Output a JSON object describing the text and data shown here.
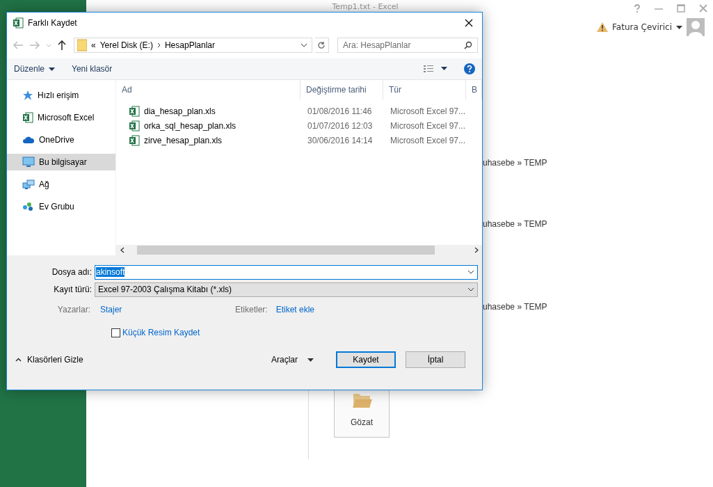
{
  "app_window": {
    "title": "Temp1.txt - Excel",
    "account": {
      "warning": "Fatura Çevirici"
    },
    "recent_paths": [
      "uhasebe » TEMP",
      "uhasebe » TEMP",
      "uhasebe » TEMP"
    ],
    "browse_tile": {
      "label": "Gözat"
    }
  },
  "dialog": {
    "title": "Farklı Kaydet",
    "address": {
      "overflow": "«",
      "segments": [
        "Yerel Disk (E:)",
        "HesapPlanlar"
      ]
    },
    "search": {
      "placeholder": "Ara: HesapPlanlar"
    },
    "toolbar": {
      "organize": "Düzenle",
      "new_folder": "Yeni klasör"
    },
    "sidebar": {
      "items": [
        {
          "label": "Hızlı erişim",
          "kind": "star",
          "selected": false
        },
        {
          "label": "Microsoft Excel",
          "kind": "excel",
          "selected": false
        },
        {
          "label": "OneDrive",
          "kind": "cloud",
          "selected": false
        },
        {
          "label": "Bu bilgisayar",
          "kind": "pc",
          "selected": true
        },
        {
          "label": "Ağ",
          "kind": "network",
          "selected": false
        },
        {
          "label": "Ev Grubu",
          "kind": "homegroup",
          "selected": false
        }
      ]
    },
    "table": {
      "columns": [
        "Ad",
        "Değiştirme tarihi",
        "Tür",
        "B"
      ],
      "rows": [
        {
          "name": "dia_hesap_plan.xls",
          "date": "01/08/2016 11:46",
          "type": "Microsoft Excel 97..."
        },
        {
          "name": "orka_sql_hesap_plan.xls",
          "date": "01/07/2016 12:03",
          "type": "Microsoft Excel 97..."
        },
        {
          "name": "zirve_hesap_plan.xls",
          "date": "30/06/2016 14:14",
          "type": "Microsoft Excel 97..."
        }
      ]
    },
    "file_name": {
      "label": "Dosya adı:",
      "value": "akinsoft"
    },
    "file_type": {
      "label": "Kayıt türü:",
      "value": "Excel 97-2003 Çalışma Kitabı (*.xls)"
    },
    "authors": {
      "label": "Yazarlar:",
      "value": "Stajer"
    },
    "tags": {
      "label": "Etiketler:",
      "value": "Etiket ekle"
    },
    "thumbnail": {
      "label": "Küçük Resim Kaydet",
      "checked": false
    },
    "hide_folders": "Klasörleri Gizle",
    "tools": "Araçlar",
    "buttons": [
      "Kaydet",
      "İptal"
    ]
  }
}
